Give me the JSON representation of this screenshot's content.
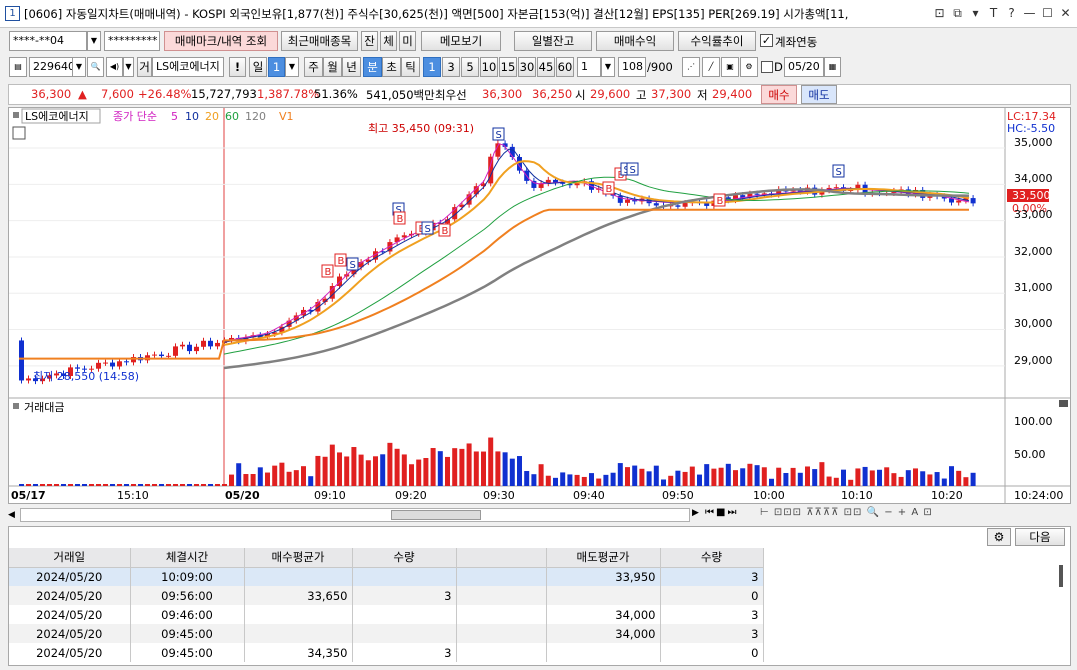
{
  "window": {
    "badge": "1",
    "title": "[0606] 자동일지차트(매매내역) - KOSPI 외국인보유[1,877(천)] 주식수[30,625(천)] 액면[500] 자본금[153(억)] 결산[12월] EPS[135] PER[269.19] 시가총액[11,",
    "controls": [
      "⊡",
      "⧉",
      "▾",
      "T",
      "?",
      "—",
      "☐",
      "✕"
    ]
  },
  "toolbar1": {
    "account": "****-**04",
    "password": "*********",
    "buttons": [
      "매매마크/내역 조회",
      "최근매매종목",
      "잔",
      "체",
      "미",
      "메모보기",
      "일별잔고",
      "매매수익",
      "수익률추이"
    ],
    "checkbox_label": "계좌연동",
    "checkbox_checked": true
  },
  "toolbar2": {
    "code": "229640",
    "name_prefix": "거",
    "stock_name": "LS에코에너지",
    "period_day": "일",
    "period_day_val": "1",
    "periods": [
      "주",
      "월",
      "년",
      "분",
      "초",
      "틱"
    ],
    "active_period": "분",
    "intervals": [
      "1",
      "3",
      "5",
      "10",
      "15",
      "30",
      "45",
      "60"
    ],
    "active_interval": "1",
    "count_select": "1",
    "count": "108",
    "total": "/900",
    "date_check": "D",
    "date": "05/20"
  },
  "pricebar": {
    "price": "36,300",
    "arrow": "▲",
    "change": "7,600",
    "rate": "+26.48%",
    "volume": "15,727,793",
    "vol_rate": "1,387.78%",
    "ratio": "51.36%",
    "amount": "541,050백만",
    "best_label": "최우선",
    "ask": "36,300",
    "bid": "36,250",
    "open_label": "시",
    "open": "29,600",
    "high_label": "고",
    "high": "37,300",
    "low_label": "저",
    "low": "29,400",
    "buy_btn": "매수",
    "sell_btn": "매도"
  },
  "chart": {
    "legend": {
      "name": "LS에코에너지",
      "ma_label": "종가 단순",
      "ma_periods": [
        "5",
        "10",
        "20",
        "60",
        "120"
      ],
      "extra": "V1"
    },
    "lc": "LC:17.34",
    "hc": "HC:-5.50",
    "high_annot": "최고 35,450 (09:31)",
    "low_annot": "최저 28,550 (14:58)",
    "current_price": "33,500",
    "current_pct": "0.00%",
    "volume_label": "거래대금",
    "volume_axis": [
      "100.00",
      "50.00"
    ],
    "price_axis": [
      "35,000",
      "34,000",
      "33,000",
      "32,000",
      "31,000",
      "30,000",
      "29,000"
    ],
    "time_labels": [
      "05/17",
      "15:10",
      "05/20",
      "09:10",
      "09:20",
      "09:30",
      "09:40",
      "09:50",
      "10:00",
      "10:10",
      "10:20",
      "10:24:00"
    ],
    "colors": {
      "up": "#e02020",
      "down": "#1030d0",
      "ma5": "#d020c0",
      "ma10": "#1030a0",
      "ma20": "#f0a020",
      "ma60": "#20a040",
      "ma120": "#808080",
      "v1": "#f08020"
    }
  },
  "chart_data": {
    "type": "line",
    "title": "",
    "xlabel": "",
    "ylabel": "",
    "series": [
      {
        "name": "종가",
        "x": [
          "05/17 15:10",
          "05/20 09:00",
          "09:05",
          "09:10",
          "09:15",
          "09:20",
          "09:25",
          "09:30",
          "09:31",
          "09:35",
          "09:40",
          "09:45",
          "09:50",
          "09:55",
          "10:00",
          "10:05",
          "10:10",
          "10:15",
          "10:20",
          "10:24"
        ],
        "values": [
          28600,
          29700,
          29900,
          30600,
          31800,
          32500,
          33000,
          34200,
          35300,
          34000,
          34100,
          33600,
          33500,
          33500,
          33700,
          33800,
          33900,
          33800,
          33700,
          33500
        ]
      }
    ],
    "ylim": [
      28500,
      35500
    ]
  },
  "grid": {
    "settings_icon": "gear-icon",
    "next_btn": "다음",
    "columns": [
      "거래일",
      "체결시간",
      "매수평균가",
      "수량",
      "",
      "매도평균가",
      "수량"
    ],
    "rows": [
      [
        "2024/05/20",
        "10:09:00",
        "",
        "",
        "",
        "33,950",
        "3"
      ],
      [
        "2024/05/20",
        "09:56:00",
        "33,650",
        "3",
        "",
        "",
        "0"
      ],
      [
        "2024/05/20",
        "09:46:00",
        "",
        "",
        "",
        "34,000",
        "3"
      ],
      [
        "2024/05/20",
        "09:45:00",
        "",
        "",
        "",
        "34,000",
        "3"
      ],
      [
        "2024/05/20",
        "09:45:00",
        "34,350",
        "3",
        "",
        "",
        "0"
      ]
    ]
  }
}
